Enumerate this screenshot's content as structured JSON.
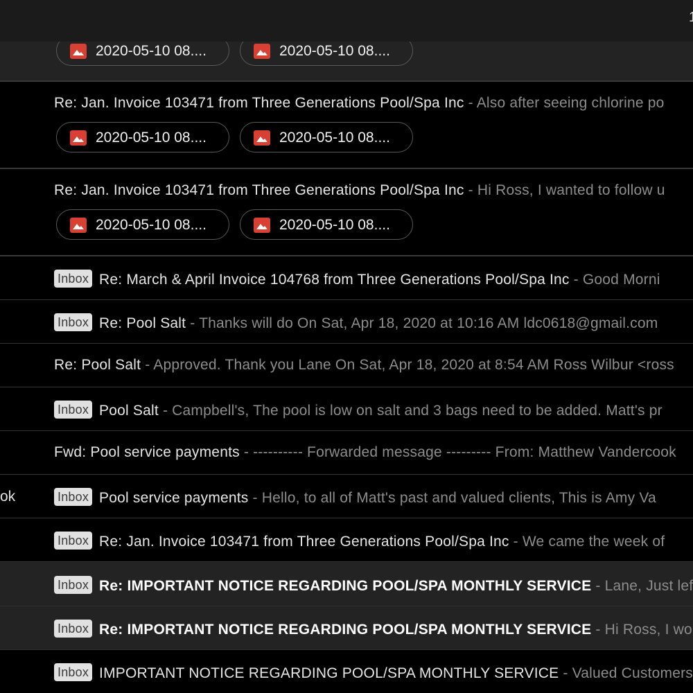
{
  "header": {
    "corner_text": "1"
  },
  "attachment_rows": [
    {
      "line": null,
      "attachments": [
        "2020-05-10 08....",
        "2020-05-10 08...."
      ]
    },
    {
      "line": {
        "subject": "Re: Jan. Invoice 103471 from Three Generations Pool/Spa Inc",
        "snippet": " - Also after seeing chlorine po"
      },
      "attachments": [
        "2020-05-10 08....",
        "2020-05-10 08...."
      ]
    },
    {
      "line": {
        "subject": "Re: Jan. Invoice 103471 from Three Generations Pool/Spa Inc",
        "snippet": " - Hi Ross, I wanted to follow u"
      },
      "attachments": [
        "2020-05-10 08....",
        "2020-05-10 08...."
      ]
    }
  ],
  "emails": [
    {
      "badge": "Inbox",
      "subject": "Re: March & April Invoice 104768 from Three Generations Pool/Spa Inc",
      "snippet": " - Good Morni",
      "left_fragment": ""
    },
    {
      "badge": "Inbox",
      "subject": "Re: Pool Salt",
      "snippet": " - Thanks will do On Sat, Apr 18, 2020 at 10:16 AM ldc0618@gmail.com",
      "left_fragment": ""
    },
    {
      "badge": "",
      "subject": "Re: Pool Salt",
      "snippet": " - Approved. Thank you Lane On Sat, Apr 18, 2020 at 8:54 AM Ross Wilbur <ross",
      "left_fragment": ""
    },
    {
      "badge": "Inbox",
      "subject": "Pool Salt",
      "snippet": " - Campbell's, The pool is low on salt and 3 bags need to be added. Matt's pr",
      "left_fragment": ""
    },
    {
      "badge": "",
      "subject": "Fwd: Pool service payments",
      "snippet": " - ---------- Forwarded message --------- From: Matthew Vandercook",
      "left_fragment": ""
    },
    {
      "badge": "Inbox",
      "subject": "Pool service payments",
      "snippet": " - Hello, to all of Matt's past and valued clients, This is Amy Va",
      "left_fragment": "ok"
    },
    {
      "badge": "Inbox",
      "subject": "Re: Jan. Invoice 103471 from Three Generations Pool/Spa Inc",
      "snippet": " - We came the week of",
      "left_fragment": ""
    },
    {
      "badge": "Inbox",
      "subject": "Re: IMPORTANT NOTICE REGARDING POOL/SPA MONTHLY SERVICE",
      "snippet": " - Lane, Just lef",
      "left_fragment": "",
      "unread": true
    },
    {
      "badge": "Inbox",
      "subject": "Re: IMPORTANT NOTICE REGARDING POOL/SPA MONTHLY SERVICE",
      "snippet": " - Hi Ross, I wo",
      "left_fragment": "",
      "unread": true
    },
    {
      "badge": "Inbox",
      "subject": "IMPORTANT NOTICE REGARDING POOL/SPA MONTHLY SERVICE",
      "snippet": " - Valued Customers",
      "left_fragment": ""
    }
  ],
  "icons": {
    "attachment": "image-file-icon"
  },
  "colors": {
    "attachment_icon": "#d84034",
    "unread_row": "#232323",
    "badge_bg": "#e1e1e1",
    "snippet": "#8d8d8d"
  }
}
